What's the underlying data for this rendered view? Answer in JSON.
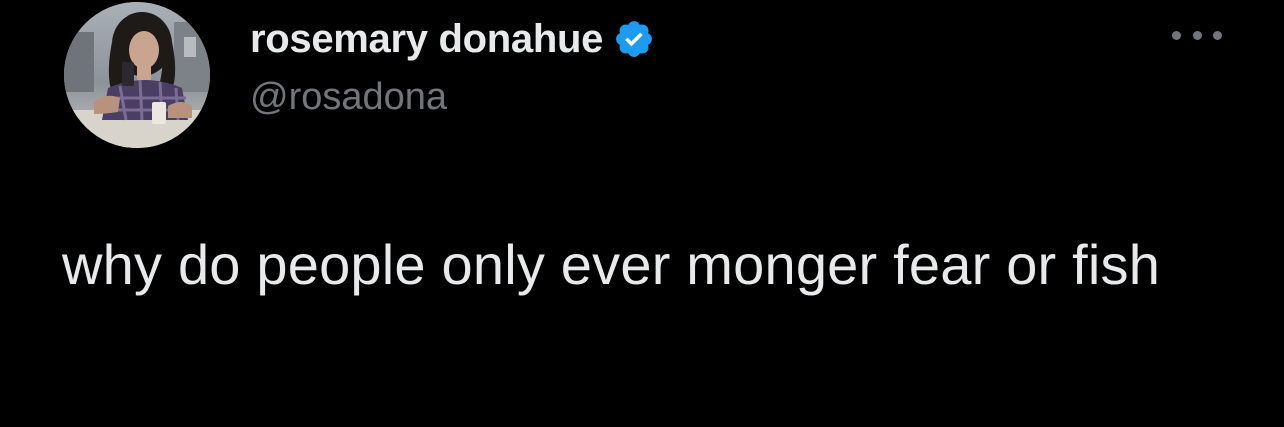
{
  "user": {
    "display_name": "rosemary donahue",
    "handle": "@rosadona",
    "verified": true,
    "avatar_icon": "profile-photo",
    "verified_icon": "verified-badge-icon"
  },
  "tweet": {
    "text": "why do people only ever monger fear or fish"
  },
  "colors": {
    "background": "#000000",
    "text": "#e7e9ea",
    "secondary_text": "#71767b",
    "verified_blue": "#1d9bf0"
  },
  "icons": {
    "more": "more-options-icon"
  }
}
